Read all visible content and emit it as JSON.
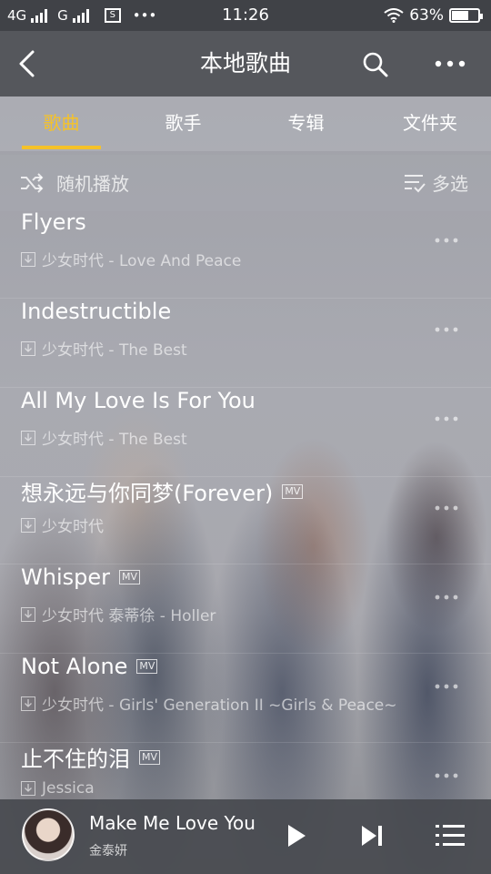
{
  "status_bar": {
    "network1": "4G",
    "network2": "G",
    "extra": "•••",
    "time": "11:26",
    "battery": "63%",
    "battery_level": 0.63
  },
  "header": {
    "title": "本地歌曲",
    "icons": [
      "back-icon",
      "search-icon",
      "more-icon"
    ]
  },
  "tabs": [
    {
      "label": "歌曲",
      "active": true
    },
    {
      "label": "歌手",
      "active": false
    },
    {
      "label": "专辑",
      "active": false
    },
    {
      "label": "文件夹",
      "active": false
    }
  ],
  "toolbar": {
    "shuffle_label": "随机播放",
    "multi_select_label": "多选"
  },
  "songs": [
    {
      "title": "Flyers",
      "mv": false,
      "subtitle": "少女时代 - Love And Peace"
    },
    {
      "title": "Indestructible",
      "mv": false,
      "subtitle": "少女时代 - The Best"
    },
    {
      "title": "All My Love Is For You",
      "mv": false,
      "subtitle": "少女时代 - The Best"
    },
    {
      "title": "想永远与你同梦(Forever)",
      "mv": true,
      "subtitle": "少女时代"
    },
    {
      "title": "Whisper",
      "mv": true,
      "subtitle": "少女时代 泰蒂徐 - Holler"
    },
    {
      "title": "Not Alone",
      "mv": true,
      "subtitle": "少女时代 - Girls' Generation II ~Girls & Peace~"
    },
    {
      "title": "止不住的泪",
      "mv": true,
      "subtitle": "Jessica"
    }
  ],
  "mv_label": "MV",
  "now_playing": {
    "title": "Make Me Love You",
    "artist": "金泰妍"
  },
  "colors": {
    "accent": "#f5c229",
    "status_bar": "#404247",
    "title_bar": "#55575c"
  }
}
